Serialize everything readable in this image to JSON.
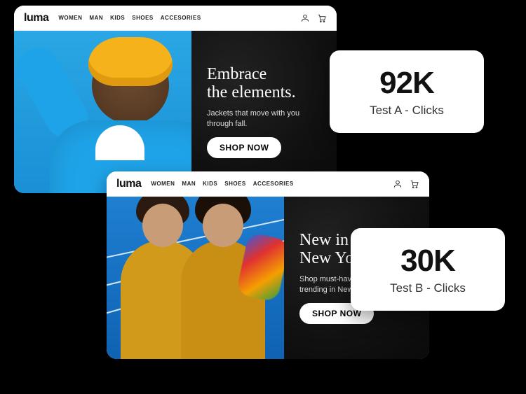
{
  "brand": "luma",
  "nav": {
    "items": [
      "WOMEN",
      "MAN",
      "KIDS",
      "SHOES",
      "ACCESORIES"
    ]
  },
  "cards": {
    "a": {
      "headline_line1": "Embrace",
      "headline_line2": "the elements.",
      "subtext": "Jackets that move with you through fall.",
      "cta": "SHOP NOW"
    },
    "b": {
      "headline_line1": "New in",
      "headline_line2": "New York.",
      "subtext": "Shop must-have fall pieces trending in New York City.",
      "cta": "SHOP NOW"
    }
  },
  "stats": {
    "a": {
      "value": "92K",
      "label": "Test A - Clicks"
    },
    "b": {
      "value": "30K",
      "label": "Test B - Clicks"
    }
  }
}
